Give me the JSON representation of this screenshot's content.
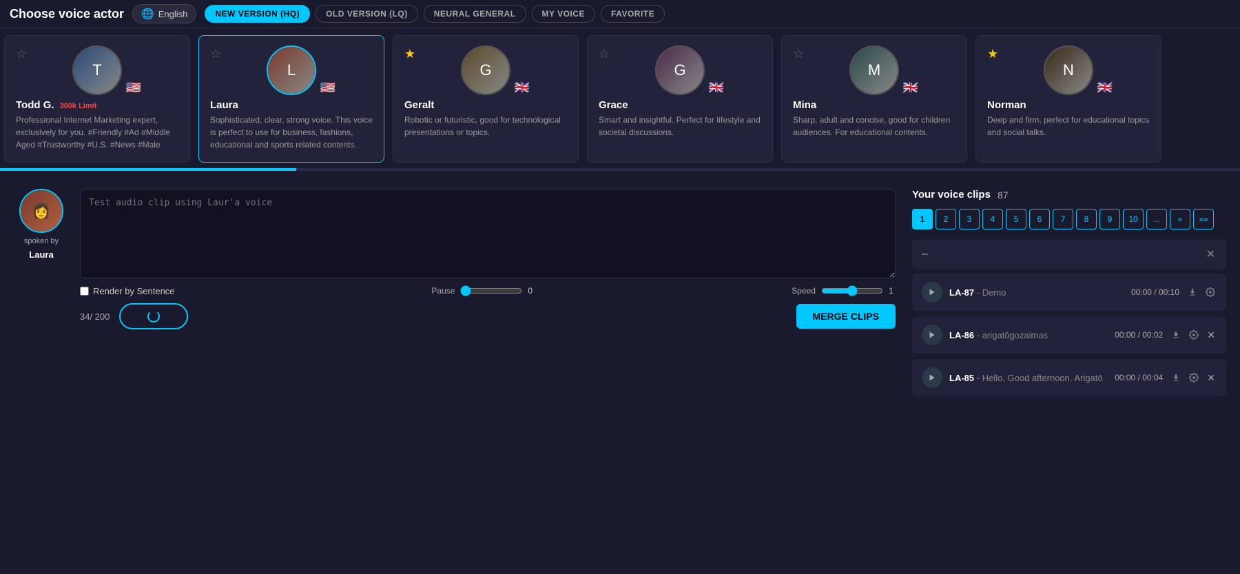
{
  "header": {
    "title": "Choose voice actor",
    "lang_btn": "English",
    "filters": [
      {
        "label": "NEW VERSION (HQ)",
        "active": true
      },
      {
        "label": "OLD VERSION (LQ)",
        "active": false
      },
      {
        "label": "NEURAL GENERAL",
        "active": false
      },
      {
        "label": "MY VOICE",
        "active": false
      },
      {
        "label": "FAVORITE",
        "active": false
      }
    ]
  },
  "voice_actors": [
    {
      "id": "todd",
      "name": "Todd G.",
      "limit": "300k Limit",
      "desc": "Professional Internet Marketing expert, exclusively for you. #Friendly #Ad #Middle Aged #Trustworthy #U.S. #News #Male",
      "flag": "🇺🇸",
      "starred": false,
      "selected": false,
      "avatar_color": "#2a4a7a",
      "avatar_letter": "T"
    },
    {
      "id": "laura",
      "name": "Laura",
      "limit": "",
      "desc": "Sophisticated, clear, strong voice. This voice is perfect to use for business, fashions, educational and sports related contents.",
      "flag": "🇺🇸",
      "starred": false,
      "selected": true,
      "avatar_color": "#7a3a2a",
      "avatar_letter": "L"
    },
    {
      "id": "geralt",
      "name": "Geralt",
      "limit": "",
      "desc": "Robotic or futuristic, good for technological presentations or topics.",
      "flag": "🇬🇧",
      "starred": true,
      "selected": false,
      "avatar_color": "#5a4a2a",
      "avatar_letter": "G"
    },
    {
      "id": "grace",
      "name": "Grace",
      "limit": "",
      "desc": "Smart and insightful. Perfect for lifestyle and societal discussions.",
      "flag": "🇬🇧",
      "starred": false,
      "selected": false,
      "avatar_color": "#4a2a4a",
      "avatar_letter": "G"
    },
    {
      "id": "mina",
      "name": "Mina",
      "limit": "",
      "desc": "Sharp, adult and concise, good for children audiences. For educational contents.",
      "flag": "🇬🇧",
      "starred": false,
      "selected": false,
      "avatar_color": "#2a4a4a",
      "avatar_letter": "M"
    },
    {
      "id": "norman",
      "name": "Norman",
      "limit": "",
      "desc": "Deep and firm, perfect for educational topics and social talks.",
      "flag": "🇬🇧",
      "starred": true,
      "selected": false,
      "avatar_color": "#3a2a1a",
      "avatar_letter": "N"
    }
  ],
  "editor": {
    "spoken_by_label": "spoken by",
    "speaker_name": "Laura",
    "placeholder": "Test audio clip using Laur'a voice",
    "render_sentence_label": "Render by Sentence",
    "pause_label": "Pause",
    "pause_value": "0",
    "speed_label": "Speed",
    "speed_value": "1",
    "char_count": "34/ 200",
    "generate_btn": "",
    "merge_btn": "MERGE CLIPS"
  },
  "voice_clips": {
    "title": "Your voice clips",
    "count": "87",
    "pagination": [
      "1",
      "2",
      "3",
      "4",
      "5",
      "6",
      "7",
      "8",
      "9",
      "10",
      "...",
      "»",
      "»»"
    ],
    "collapsed_item": "–",
    "items": [
      {
        "id": "LA-87",
        "name": "Demo",
        "time": "00:00 / 00:10",
        "has_delete": false
      },
      {
        "id": "LA-86",
        "name": "arigatōgozaimas",
        "time": "00:00 / 00:02",
        "has_delete": true
      },
      {
        "id": "LA-85",
        "name": "Hello. Good afternoon. Arigatōgozaim...",
        "time": "00:00 / 00:04",
        "has_delete": true
      }
    ]
  }
}
